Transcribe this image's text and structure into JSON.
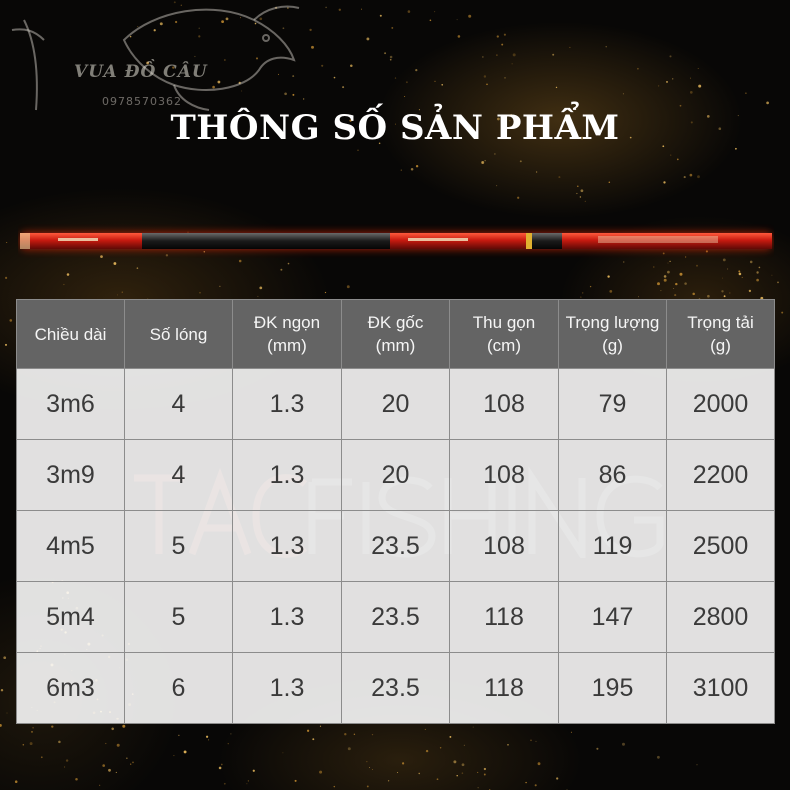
{
  "brand": {
    "logo_name": "VUA ĐỒ CÂU",
    "logo_phone": "0978570362",
    "watermark": "TAC FISHING"
  },
  "title": "THÔNG SỐ SẢN PHẨM",
  "colors": {
    "rod_red": "#c81a10",
    "header_bg": "#646464",
    "cell_bg": "#ffffff",
    "border": "#8c8c8c"
  },
  "table": {
    "headers": [
      [
        "Chiều dài"
      ],
      [
        "Số lóng"
      ],
      [
        "ĐK ngọn",
        "(mm)"
      ],
      [
        "ĐK gốc",
        "(mm)"
      ],
      [
        "Thu gọn",
        "(cm)"
      ],
      [
        "Trọng lượng",
        "(g)"
      ],
      [
        "Trọng tải",
        "(g)"
      ]
    ],
    "rows": [
      [
        "3m6",
        "4",
        "1.3",
        "20",
        "108",
        "79",
        "2000"
      ],
      [
        "3m9",
        "4",
        "1.3",
        "20",
        "108",
        "86",
        "2200"
      ],
      [
        "4m5",
        "5",
        "1.3",
        "23.5",
        "108",
        "119",
        "2500"
      ],
      [
        "5m4",
        "5",
        "1.3",
        "23.5",
        "118",
        "147",
        "2800"
      ],
      [
        "6m3",
        "6",
        "1.3",
        "23.5",
        "118",
        "195",
        "3100"
      ]
    ]
  }
}
